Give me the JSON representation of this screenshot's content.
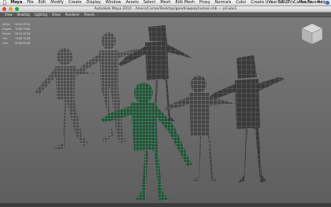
{
  "menubar": {
    "app_name": "Maya",
    "items": [
      "File",
      "Edit",
      "Modify",
      "Create",
      "Display",
      "Window",
      "Assets",
      "Select",
      "Mesh",
      "Edit Mesh",
      "Proxy",
      "Normals",
      "Color",
      "Create UVs",
      "Edit UVs",
      "Muscle",
      "Help"
    ],
    "clock": "mar 12:27",
    "user": "Carlos Taverez"
  },
  "window": {
    "title": "Autodesk Maya 2010 - /Users/Carlos/Desktop/goodlowpolyhuman.mb --- pCube1"
  },
  "panel_menu": {
    "items": [
      "View",
      "Shading",
      "Lighting",
      "Show",
      "Renderer",
      "Panels"
    ]
  },
  "hud": {
    "rows": [
      {
        "label": "Verts:",
        "v1": "3534",
        "v2": "3534"
      },
      {
        "label": "Edges:",
        "v1": "7068",
        "v2": "7068"
      },
      {
        "label": "Faces:",
        "v1": "3534",
        "v2": "3534"
      },
      {
        "label": "Tris:",
        "v1": "7068",
        "v2": "7068"
      },
      {
        "label": "UVs:",
        "v1": "5048",
        "v2": "5048"
      }
    ]
  },
  "colors": {
    "selected": "#3df59a",
    "mesh_dark": "#4a4a4a",
    "mesh_light": "#c9c9c9"
  }
}
